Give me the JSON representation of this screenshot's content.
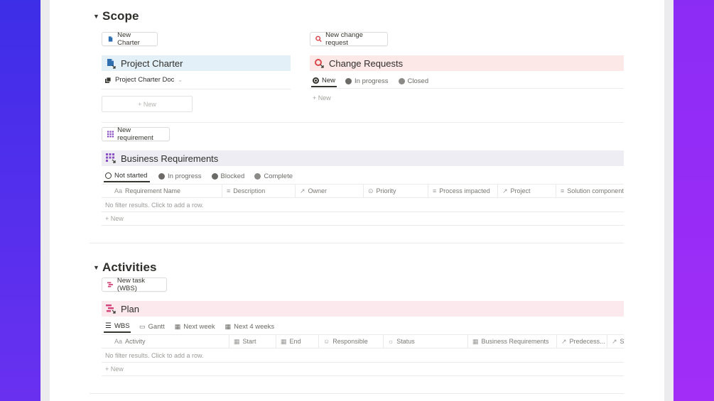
{
  "scope": {
    "heading": "Scope",
    "new_charter_btn": "New Charter",
    "new_change_btn": "New change request",
    "charter_title": "Project Charter",
    "charter_doc": "Project Charter Doc",
    "charter_new": "+ New",
    "change_title": "Change Requests",
    "change_tabs": [
      "New",
      "In progress",
      "Closed"
    ],
    "change_new": "+ New",
    "new_req_btn": "New requirement",
    "req_title": "Business Requirements",
    "req_tabs": [
      "Not started",
      "In progress",
      "Blocked",
      "Complete"
    ],
    "req_columns": [
      "Requirement Name",
      "Description",
      "Owner",
      "Priority",
      "Process impacted",
      "Project",
      "Solution component"
    ],
    "req_empty": "No filter results. Click to add a row.",
    "req_new": "+ New"
  },
  "activities": {
    "heading": "Activities",
    "new_task_btn": "New task (WBS)",
    "plan_title": "Plan",
    "plan_tabs": [
      "WBS",
      "Gantt",
      "Next week",
      "Next 4 weeks"
    ],
    "plan_columns": [
      "Activity",
      "Start",
      "End",
      "Responsible",
      "Status",
      "Business Requirements",
      "Predecess...",
      "Su"
    ],
    "plan_empty": "No filter results. Click to add a row.",
    "plan_new": "+ New"
  },
  "colors": {
    "bg_left": "#3d2ee8",
    "bg_right": "#a22df7",
    "charter_banner": "#e3f0f7",
    "change_banner": "#fde8e8",
    "req_banner": "#eeedf3",
    "plan_banner": "#fce9ee"
  },
  "icons": {
    "toggle": "▼",
    "aa": "Aa"
  }
}
